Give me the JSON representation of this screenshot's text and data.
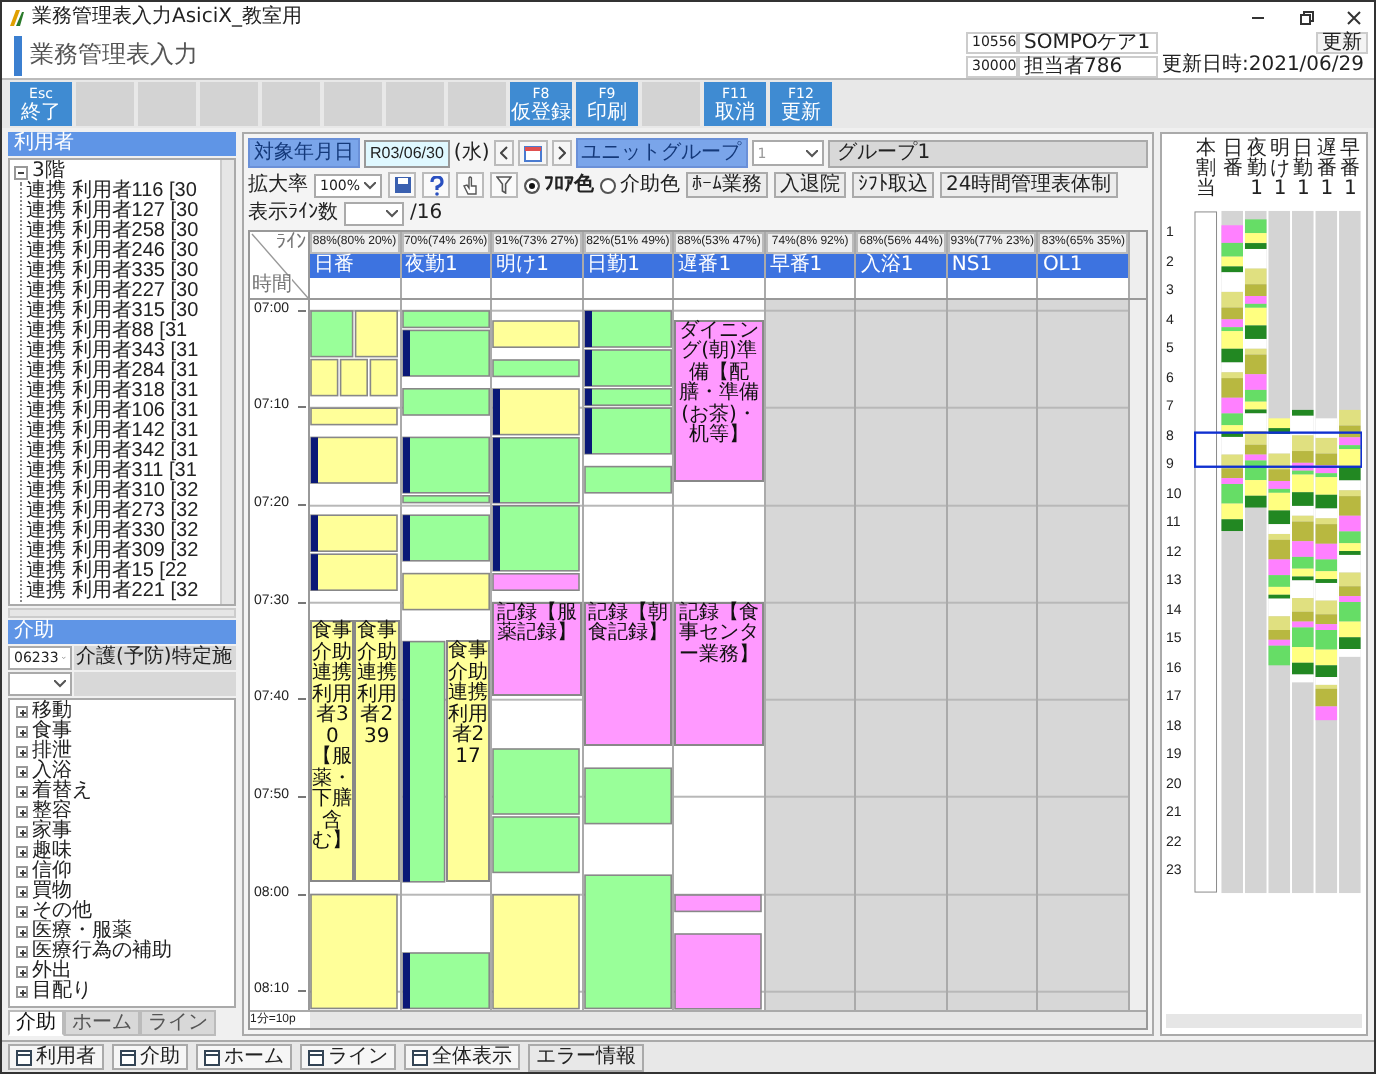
{
  "window": {
    "title": "業務管理表入力AsiciX_教室用"
  },
  "header": {
    "title": "業務管理表入力",
    "office_code": "10556",
    "office_name": "SOMPOケア1",
    "refresh_button": "更新",
    "staff_code": "30000",
    "staff_name": "担当者786",
    "updated": "更新日時:2021/06/29"
  },
  "function_keys": [
    {
      "kind": "labeled",
      "key": "Esc",
      "label": "終了"
    },
    {
      "kind": "blank"
    },
    {
      "kind": "blank"
    },
    {
      "kind": "blank"
    },
    {
      "kind": "blank"
    },
    {
      "kind": "blank"
    },
    {
      "kind": "blank"
    },
    {
      "kind": "blank"
    },
    {
      "kind": "labeled",
      "key": "F8",
      "label": "仮登録"
    },
    {
      "kind": "labeled",
      "key": "F9",
      "label": "印刷"
    },
    {
      "kind": "blank"
    },
    {
      "kind": "labeled",
      "key": "F11",
      "label": "取消"
    },
    {
      "kind": "labeled",
      "key": "F12",
      "label": "更新"
    }
  ],
  "residents_panel": {
    "title": "利用者",
    "tree": {
      "label": "3階",
      "expanded": true,
      "children": [
        {
          "label": "連携 利用者116 [30"
        },
        {
          "label": "連携 利用者127 [30"
        },
        {
          "label": "連携 利用者258 [30"
        },
        {
          "label": "連携 利用者246 [30"
        },
        {
          "label": "連携 利用者335 [30"
        },
        {
          "label": "連携 利用者227 [30"
        },
        {
          "label": "連携 利用者315 [30"
        },
        {
          "label": "連携 利用者88 [31"
        },
        {
          "label": "連携 利用者343 [31"
        },
        {
          "label": "連携 利用者284 [31"
        },
        {
          "label": "連携 利用者318 [31"
        },
        {
          "label": "連携 利用者106 [31"
        },
        {
          "label": "連携 利用者142 [31"
        },
        {
          "label": "連携 利用者342 [31"
        },
        {
          "label": "連携 利用者311 [31"
        },
        {
          "label": "連携 利用者310 [32"
        },
        {
          "label": "連携 利用者273 [32"
        },
        {
          "label": "連携 利用者330 [32"
        },
        {
          "label": "連携 利用者309 [32"
        },
        {
          "label": "連携 利用者15 [22"
        },
        {
          "label": "連携 利用者221 [32"
        }
      ]
    }
  },
  "care_panel": {
    "title": "介助",
    "code": "06233",
    "service": "介護(予防)特定施",
    "categories": [
      {
        "label": "移動",
        "expanded": false
      },
      {
        "label": "食事",
        "expanded": false
      },
      {
        "label": "排泄",
        "expanded": false
      },
      {
        "label": "入浴",
        "expanded": false
      },
      {
        "label": "着替え",
        "expanded": false
      },
      {
        "label": "整容",
        "expanded": false
      },
      {
        "label": "家事",
        "expanded": false
      },
      {
        "label": "趣味",
        "expanded": false
      },
      {
        "label": "信仰",
        "expanded": false
      },
      {
        "label": "買物",
        "expanded": false
      },
      {
        "label": "その他",
        "expanded": false
      },
      {
        "label": "医療・服薬",
        "expanded": false
      },
      {
        "label": "医療行為の補助",
        "expanded": false
      },
      {
        "label": "外出",
        "expanded": false
      },
      {
        "label": "目配り",
        "expanded": false
      }
    ]
  },
  "left_tabs": [
    {
      "label": "介助",
      "selected": true
    },
    {
      "label": "ホーム",
      "selected": false
    },
    {
      "label": "ライン",
      "selected": false
    }
  ],
  "toolbar": {
    "date_label": "対象年月日",
    "date": "R03/06/30",
    "weekday": "(水)",
    "group_label": "ユニットグループ",
    "group_number": "1",
    "group_name": "グループ1"
  },
  "display_bar": {
    "zoom_label": "拡大率",
    "zoom": "100%",
    "color_modes": [
      {
        "label": "ﾌﾛｱ色",
        "selected": true
      },
      {
        "label": "介助色",
        "selected": false
      }
    ],
    "buttons": [
      "ﾎｰﾑ業務",
      "入退院",
      "ｼﾌﾄ取込",
      "24時間管理表体制"
    ],
    "lines_label": "表示ﾗｲﾝ数",
    "lines_total": "/16"
  },
  "schedule": {
    "corner_top": "ﾗｲﾝ",
    "corner_bottom": "時間",
    "scale": "1分=10p",
    "times": [
      "07:00",
      "07:10",
      "07:20",
      "07:30",
      "07:40",
      "07:50",
      "08:00",
      "08:10"
    ],
    "columns": [
      {
        "load": "88%(80% 20%)",
        "name": "日番",
        "shaded": false,
        "events": [
          {
            "text": "食事介助連携利用者30【服薬・下膳含む】",
            "color": "#ffff99"
          },
          {
            "text": "食事介助連携利用者239",
            "color": "#ffff99"
          }
        ]
      },
      {
        "load": "70%(74% 26%)",
        "name": "夜勤1",
        "shaded": false,
        "events": [
          {
            "text": "食事介助連携利用者217",
            "color": "#ffff99"
          }
        ]
      },
      {
        "load": "91%(73% 27%)",
        "name": "明け1",
        "shaded": false,
        "events": [
          {
            "text": "記録【服薬記録】",
            "color": "#ff99ff"
          }
        ]
      },
      {
        "load": "82%(51% 49%)",
        "name": "日勤1",
        "shaded": false,
        "events": [
          {
            "text": "記録【朝食記録】",
            "color": "#ff99ff"
          }
        ]
      },
      {
        "load": "88%(53% 47%)",
        "name": "遅番1",
        "shaded": false,
        "events": [
          {
            "text": "ダイニング(朝)準備【配膳・準備(お茶)・机等】",
            "color": "#ff99ff"
          },
          {
            "text": "記録【食事センター業務】",
            "color": "#ff99ff"
          }
        ]
      },
      {
        "load": "74%(8% 92%)",
        "name": "早番1",
        "shaded": true
      },
      {
        "load": "68%(56% 44%)",
        "name": "入浴1",
        "shaded": true
      },
      {
        "load": "93%(77% 23%)",
        "name": "NS1",
        "shaded": true
      },
      {
        "load": "83%(65% 35%)",
        "name": "OL1",
        "shaded": true
      }
    ]
  },
  "overview": {
    "columns": [
      "本割当",
      "日番",
      "夜勤1",
      "明け1",
      "日勤1",
      "遅番1",
      "早番1"
    ],
    "hours": [
      "1",
      "2",
      "3",
      "4",
      "5",
      "6",
      "7",
      "8",
      "9",
      "10",
      "11",
      "12",
      "13",
      "14",
      "15",
      "16",
      "17",
      "18",
      "19",
      "20",
      "21",
      "22",
      "23"
    ]
  },
  "status_bar": [
    {
      "kind": "button",
      "label": "利用者"
    },
    {
      "kind": "button",
      "label": "介助"
    },
    {
      "kind": "button",
      "label": "ホーム"
    },
    {
      "kind": "button",
      "label": "ライン"
    },
    {
      "kind": "button",
      "label": "全体表示"
    },
    {
      "kind": "text",
      "label": "エラー情報"
    }
  ]
}
